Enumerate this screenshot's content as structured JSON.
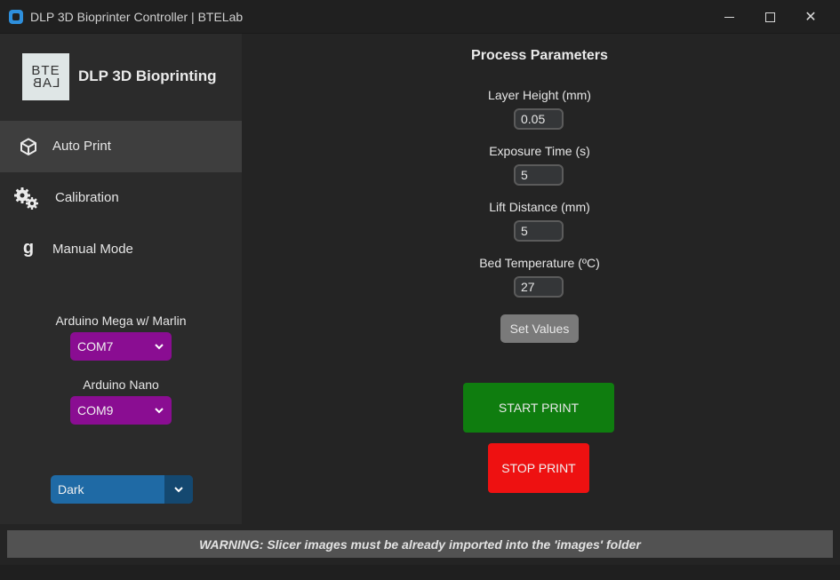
{
  "window": {
    "title": "DLP 3D Bioprinter Controller | BTELab",
    "minimize_icon": "minimize-icon",
    "maximize_icon": "maximize-icon",
    "close_glyph": "✕"
  },
  "sidebar": {
    "logo_lines": [
      "BTE",
      "LAB"
    ],
    "title": "DLP 3D Bioprinting",
    "nav": [
      {
        "label": "Auto Print",
        "icon": "cube-icon",
        "active": true
      },
      {
        "label": "Calibration",
        "icon": "gears-icon",
        "active": false
      },
      {
        "label": "Manual Mode",
        "icon": "g-icon",
        "active": false
      }
    ],
    "g_icon_glyph": "g",
    "ports": [
      {
        "label": "Arduino Mega w/ Marlin",
        "value": "COM7"
      },
      {
        "label": "Arduino Nano",
        "value": "COM9"
      }
    ],
    "theme": {
      "value": "Dark"
    },
    "accent_purple": "#8a0d92",
    "accent_blue": "#1f6aa5"
  },
  "main": {
    "title": "Process Parameters",
    "params": [
      {
        "label": "Layer Height (mm)",
        "value": "0.05"
      },
      {
        "label": "Exposure Time (s)",
        "value": "5"
      },
      {
        "label": "Lift Distance (mm)",
        "value": "5"
      },
      {
        "label": "Bed Temperature (ºC)",
        "value": "27"
      }
    ],
    "set_button": "Set Values",
    "start_button": "START PRINT",
    "stop_button": "STOP PRINT",
    "start_color": "#0f7d0f",
    "stop_color": "#ee1111"
  },
  "footer": {
    "warning": "WARNING: Slicer images must be already imported into the 'images' folder"
  }
}
